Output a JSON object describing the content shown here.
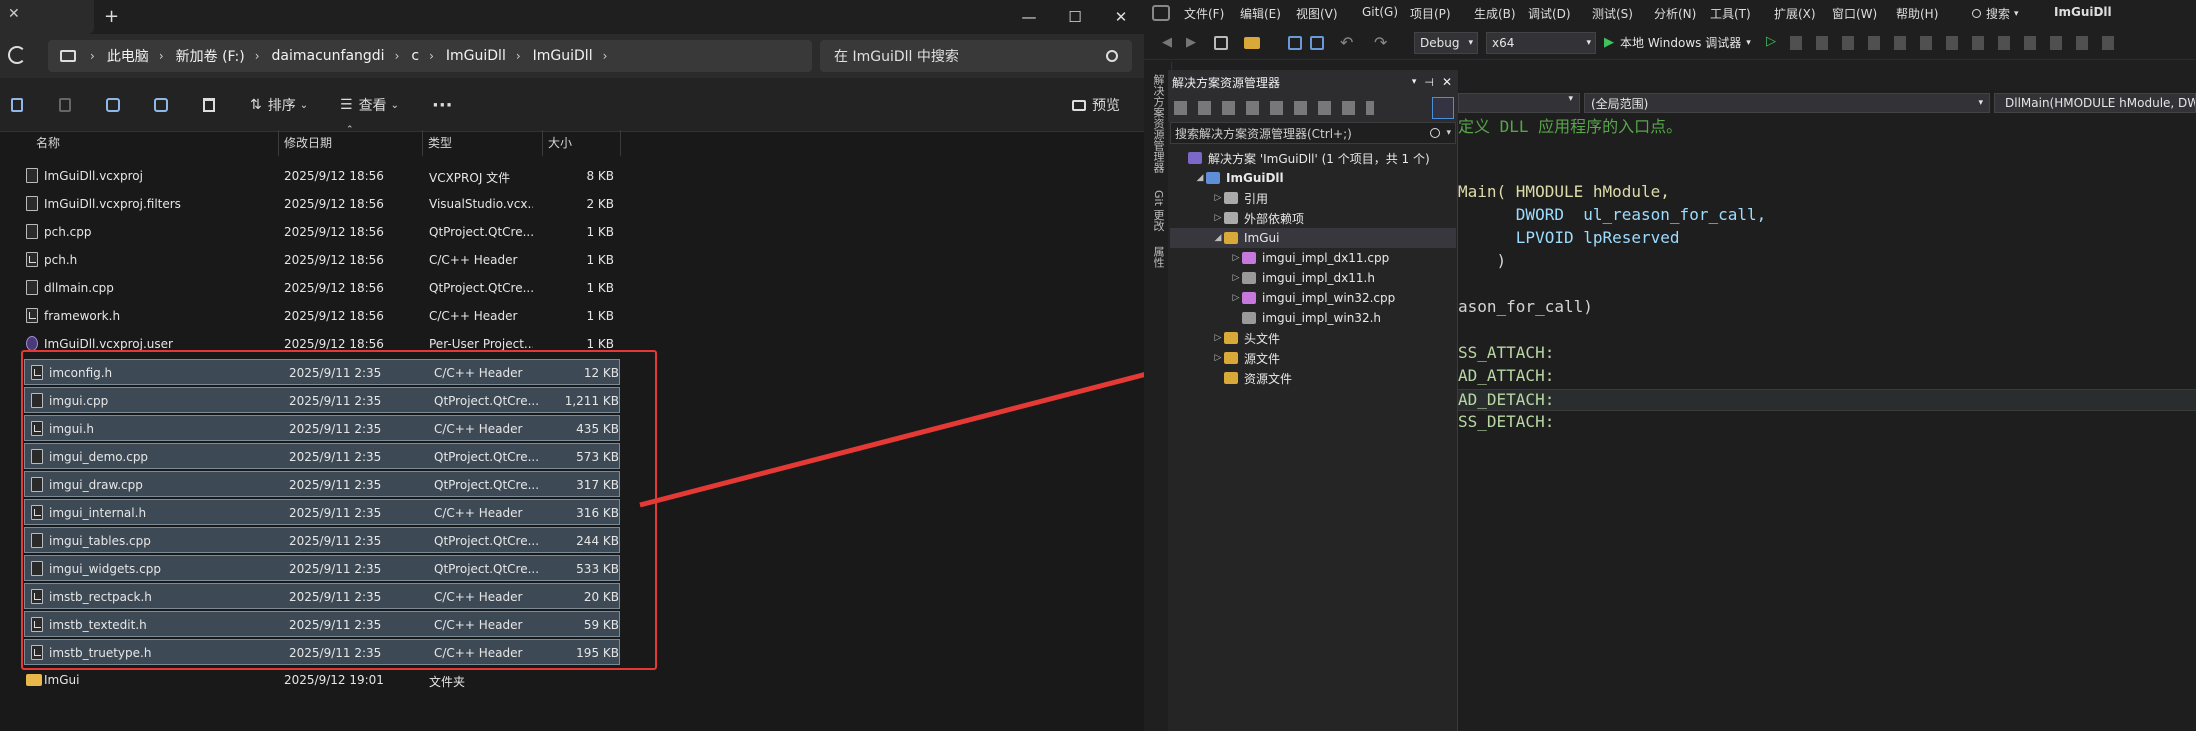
{
  "explorer": {
    "window": {
      "minimize": "—",
      "maximize": "☐",
      "close": "✕",
      "new_tab": "+"
    },
    "breadcrumb": [
      "此电脑",
      "新加卷 (F:)",
      "daimacunfangdi",
      "c",
      "ImGuiDll",
      "ImGuiDll"
    ],
    "search_placeholder": "在 ImGuiDll 中搜索",
    "toolbar": {
      "sort": "排序",
      "view": "查看",
      "more": "···",
      "preview": "预览"
    },
    "columns": {
      "name": "名称",
      "date": "修改日期",
      "type": "类型",
      "size": "大小"
    },
    "files": [
      {
        "name": "ImGuiDll.vcxproj",
        "date": "2025/9/12 18:56",
        "type": "VCXPROJ 文件",
        "size": "8 KB",
        "icon": "file",
        "sel": false
      },
      {
        "name": "ImGuiDll.vcxproj.filters",
        "date": "2025/9/12 18:56",
        "type": "VisualStudio.vcx...",
        "size": "2 KB",
        "icon": "file",
        "sel": false
      },
      {
        "name": "pch.cpp",
        "date": "2025/9/12 18:56",
        "type": "QtProject.QtCre...",
        "size": "1 KB",
        "icon": "file",
        "sel": false
      },
      {
        "name": "pch.h",
        "date": "2025/9/12 18:56",
        "type": "C/C++ Header",
        "size": "1 KB",
        "icon": "code",
        "sel": false
      },
      {
        "name": "dllmain.cpp",
        "date": "2025/9/12 18:56",
        "type": "QtProject.QtCre...",
        "size": "1 KB",
        "icon": "file",
        "sel": false
      },
      {
        "name": "framework.h",
        "date": "2025/9/12 18:56",
        "type": "C/C++ Header",
        "size": "1 KB",
        "icon": "code",
        "sel": false
      },
      {
        "name": "ImGuiDll.vcxproj.user",
        "date": "2025/9/12 18:56",
        "type": "Per-User Project...",
        "size": "1 KB",
        "icon": "user",
        "sel": false
      },
      {
        "name": "imconfig.h",
        "date": "2025/9/11 2:35",
        "type": "C/C++ Header",
        "size": "12 KB",
        "icon": "code",
        "sel": true
      },
      {
        "name": "imgui.cpp",
        "date": "2025/9/11 2:35",
        "type": "QtProject.QtCre...",
        "size": "1,211 KB",
        "icon": "file",
        "sel": true
      },
      {
        "name": "imgui.h",
        "date": "2025/9/11 2:35",
        "type": "C/C++ Header",
        "size": "435 KB",
        "icon": "code",
        "sel": true
      },
      {
        "name": "imgui_demo.cpp",
        "date": "2025/9/11 2:35",
        "type": "QtProject.QtCre...",
        "size": "573 KB",
        "icon": "file",
        "sel": true
      },
      {
        "name": "imgui_draw.cpp",
        "date": "2025/9/11 2:35",
        "type": "QtProject.QtCre...",
        "size": "317 KB",
        "icon": "file",
        "sel": true
      },
      {
        "name": "imgui_internal.h",
        "date": "2025/9/11 2:35",
        "type": "C/C++ Header",
        "size": "316 KB",
        "icon": "code",
        "sel": true
      },
      {
        "name": "imgui_tables.cpp",
        "date": "2025/9/11 2:35",
        "type": "QtProject.QtCre...",
        "size": "244 KB",
        "icon": "file",
        "sel": true
      },
      {
        "name": "imgui_widgets.cpp",
        "date": "2025/9/11 2:35",
        "type": "QtProject.QtCre...",
        "size": "533 KB",
        "icon": "file",
        "sel": true
      },
      {
        "name": "imstb_rectpack.h",
        "date": "2025/9/11 2:35",
        "type": "C/C++ Header",
        "size": "20 KB",
        "icon": "code",
        "sel": true
      },
      {
        "name": "imstb_textedit.h",
        "date": "2025/9/11 2:35",
        "type": "C/C++ Header",
        "size": "59 KB",
        "icon": "code",
        "sel": true
      },
      {
        "name": "imstb_truetype.h",
        "date": "2025/9/11 2:35",
        "type": "C/C++ Header",
        "size": "195 KB",
        "icon": "code",
        "sel": true
      },
      {
        "name": "ImGui",
        "date": "2025/9/12 19:01",
        "type": "文件夹",
        "size": "",
        "icon": "folder",
        "sel": false
      }
    ]
  },
  "vs": {
    "menus": [
      "文件(F)",
      "编辑(E)",
      "视图(V)",
      "Git(G)",
      "项目(P)",
      "生成(B)",
      "调试(D)",
      "测试(S)",
      "分析(N)",
      "工具(T)",
      "扩展(X)",
      "窗口(W)",
      "帮助(H)"
    ],
    "search_label": "搜索",
    "solution_title": "ImGuiDll",
    "config": "Debug",
    "platform": "x64",
    "run_label": "本地 Windows 调试器",
    "side_tabs": [
      "解决方案资源管理器",
      "Git 更改",
      "属性"
    ],
    "se": {
      "title": "解决方案资源管理器",
      "search_placeholder": "搜索解决方案资源管理器(Ctrl+;)",
      "tree": [
        {
          "label": "解决方案 'ImGuiDll' (1 个项目，共 1 个)",
          "depth": 0,
          "arrow": "",
          "icon": "solution",
          "sel": false
        },
        {
          "label": "ImGuiDll",
          "depth": 1,
          "arrow": "◢",
          "icon": "project",
          "sel": false
        },
        {
          "label": "引用",
          "depth": 2,
          "arrow": "▷",
          "icon": "ref",
          "sel": false
        },
        {
          "label": "外部依赖项",
          "depth": 2,
          "arrow": "▷",
          "icon": "ext",
          "sel": false
        },
        {
          "label": "ImGui",
          "depth": 2,
          "arrow": "◢",
          "icon": "filter",
          "sel": true
        },
        {
          "label": "imgui_impl_dx11.cpp",
          "depth": 3,
          "arrow": "▷",
          "icon": "cpp",
          "sel": false
        },
        {
          "label": "imgui_impl_dx11.h",
          "depth": 3,
          "arrow": "▷",
          "icon": "h",
          "sel": false
        },
        {
          "label": "imgui_impl_win32.cpp",
          "depth": 3,
          "arrow": "▷",
          "icon": "cpp",
          "sel": false
        },
        {
          "label": "imgui_impl_win32.h",
          "depth": 3,
          "arrow": "",
          "icon": "h",
          "sel": false
        },
        {
          "label": "头文件",
          "depth": 2,
          "arrow": "▷",
          "icon": "filter",
          "sel": false
        },
        {
          "label": "源文件",
          "depth": 2,
          "arrow": "▷",
          "icon": "filter",
          "sel": false
        },
        {
          "label": "资源文件",
          "depth": 2,
          "arrow": "",
          "icon": "filter",
          "sel": false
        }
      ]
    },
    "editor": {
      "scope": "(全局范围)",
      "function": "DllMain(HMODULE hModule, DWORD",
      "lines": [
        {
          "t": "定义 DLL 应用程序的入口点。",
          "cls": "cmt"
        },
        {
          "t": "",
          "cls": ""
        },
        {
          "t": "",
          "cls": ""
        },
        {
          "t": "Main( HMODULE hModule,",
          "cls": "mix1"
        },
        {
          "t": "      DWORD  ul_reason_for_call,",
          "cls": "mix2"
        },
        {
          "t": "      LPVOID lpReserved",
          "cls": "mix2"
        },
        {
          "t": "    )",
          "cls": "plain"
        },
        {
          "t": "",
          "cls": ""
        },
        {
          "t": "ason_for_call)",
          "cls": "plain"
        },
        {
          "t": "",
          "cls": ""
        },
        {
          "t": "SS_ATTACH:",
          "cls": "mac"
        },
        {
          "t": "AD_ATTACH:",
          "cls": "mac"
        },
        {
          "t": "AD_DETACH:",
          "cls": "mac"
        },
        {
          "t": "SS_DETACH:",
          "cls": "mac"
        }
      ]
    }
  }
}
